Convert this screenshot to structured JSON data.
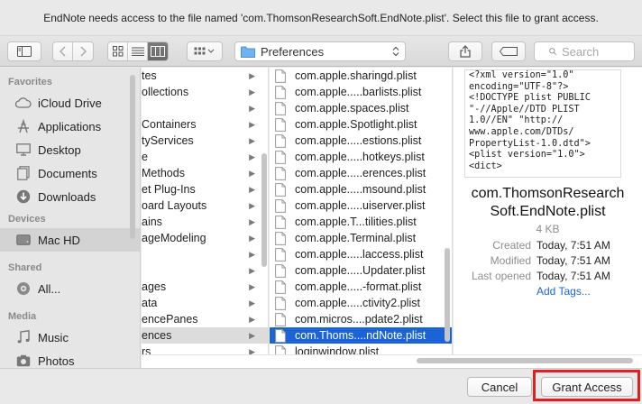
{
  "dialog": {
    "message": "EndNote needs access to the file named 'com.ThomsonResearchSoft.EndNote.plist'. Select this file to grant access."
  },
  "toolbar": {
    "path_label": "Preferences",
    "search_placeholder": "Search"
  },
  "sidebar": {
    "favorites_heading": "Favorites",
    "favorites": [
      {
        "label": "iCloud Drive",
        "icon": "cloud-icon"
      },
      {
        "label": "Applications",
        "icon": "applications-icon"
      },
      {
        "label": "Desktop",
        "icon": "desktop-icon"
      },
      {
        "label": "Documents",
        "icon": "documents-icon"
      },
      {
        "label": "Downloads",
        "icon": "downloads-icon"
      }
    ],
    "devices_heading": "Devices",
    "devices": [
      {
        "label": "Mac HD",
        "icon": "harddisk-icon"
      }
    ],
    "shared_heading": "Shared",
    "shared": [
      {
        "label": "All...",
        "icon": "network-icon"
      }
    ],
    "media_heading": "Media",
    "media": [
      {
        "label": "Music",
        "icon": "music-icon"
      },
      {
        "label": "Photos",
        "icon": "photos-icon"
      }
    ]
  },
  "column1": {
    "items": [
      "tes",
      "ollections",
      "",
      "Containers",
      "tyServices",
      "e",
      "Methods",
      "et Plug-Ins",
      "oard Layouts",
      "ains",
      "ageModeling",
      "",
      "",
      "ages",
      "ata",
      "encePanes",
      "ences",
      "rs"
    ]
  },
  "column2": {
    "items": [
      "com.apple.sharingd.plist",
      "com.apple.....barlists.plist",
      "com.apple.spaces.plist",
      "com.apple.Spotlight.plist",
      "com.apple.....estions.plist",
      "com.apple.....hotkeys.plist",
      "com.apple.....erences.plist",
      "com.apple.....msound.plist",
      "com.apple.....uiserver.plist",
      "com.apple.T...tilities.plist",
      "com.apple.Terminal.plist",
      "com.apple.....laccess.plist",
      "com.apple.....Updater.plist",
      "com.apple.....-format.plist",
      "com.apple.....ctivity2.plist",
      "com.micros....pdate2.plist",
      "com.Thoms....ndNote.plist",
      "loginwindow.plist"
    ]
  },
  "preview": {
    "text": "<?xml version=\"1.0\"\nencoding=\"UTF-8\"?>\n<!DOCTYPE plist PUBLIC\n\"-//Apple//DTD PLIST\n1.0//EN\" \"http://\nwww.apple.com/DTDs/\nPropertyList-1.0.dtd\">\n<plist version=\"1.0\">\n<dict>",
    "name_line1": "com.ThomsonResearch",
    "name_line2": "Soft.EndNote.plist",
    "size": "4 KB",
    "created_label": "Created",
    "created_value": "Today, 7:51 AM",
    "modified_label": "Modified",
    "modified_value": "Today, 7:51 AM",
    "opened_label": "Last opened",
    "opened_value": "Today, 7:51 AM",
    "add_tags": "Add Tags..."
  },
  "footer": {
    "cancel_label": "Cancel",
    "grant_label": "Grant Access"
  },
  "colors": {
    "selection_blue": "#1a64d6",
    "highlight_red": "#e01f1f",
    "link_blue": "#1b66d0"
  }
}
